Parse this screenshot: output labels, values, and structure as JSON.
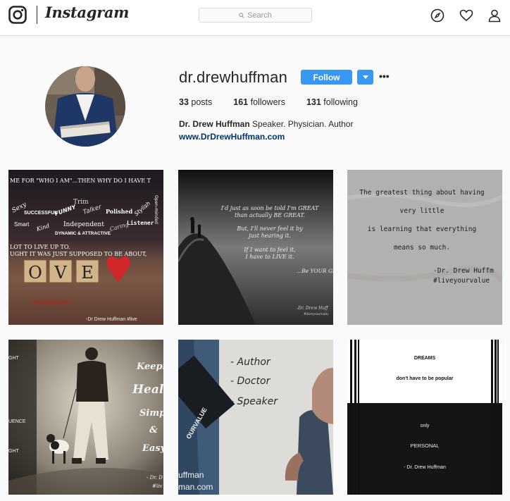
{
  "nav": {
    "wordmark": "Instagram",
    "search_placeholder": "Search",
    "icons": [
      "instagram-logo-icon",
      "search-icon",
      "compass-icon",
      "heart-icon",
      "person-icon"
    ]
  },
  "profile": {
    "username": "dr.drewhuffman",
    "follow_label": "Follow",
    "more_label": "•••",
    "posts_count": "33",
    "posts_label": "posts",
    "followers_count": "161",
    "followers_label": "followers",
    "following_count": "131",
    "following_label": "following",
    "full_name": "Dr. Drew Huffman",
    "bio": "Speaker. Physician. Author",
    "website": "www.DrDrewHuffman.com"
  },
  "posts": {
    "post1": {
      "line1": "ME FOR \"WHO I AM\"...THEN WHY DO I HAVE T",
      "words": [
        "Sexy",
        "SUCCESSFUL",
        "FUNNY",
        "Trim",
        "Talker",
        "Polished",
        "Stylish",
        "Open-minded",
        "Smart",
        "Kind",
        "Independent",
        "Caring",
        "Listener",
        "DYNAMIC & ATTRACTIVE"
      ],
      "line2": "LOT TO LIVE UP TO.",
      "line3": "UGHT IT WAS JUST SUPPOSED TO BE ABOUT,",
      "tiles": [
        "O",
        "V",
        "E"
      ],
      "sig": "-Dr Drew Huffman   #live"
    },
    "post2": {
      "l1": "I'd just as soon be told I'm GREAT",
      "l2": "than actually BE GREAT.",
      "l3": "But, I'll never feel it by",
      "l4": "just hearing it.",
      "l5": "If I want to feel it,",
      "l6": "I have to LIVE it.",
      "l7": "...Be YOUR GR",
      "sig1": "-Dr. Drew Huff",
      "sig2": "#liveyourvalu"
    },
    "post3": {
      "l1": "The greatest thing about having",
      "l2": "very little",
      "l3": "is learning that everything",
      "l4": "means so much.",
      "sig1": "-Dr. Drew Huffm",
      "sig2": "#liveyourvalue"
    },
    "post4": {
      "w1": "Keepin",
      "w2": "Healt",
      "w3": "Simp",
      "w4": "&",
      "w5": "Easy",
      "l1": "GHT",
      "l2": "UENCE",
      "l3": "GHT",
      "sig1": "- Dr. D",
      "sig2": "#liv"
    },
    "post5": {
      "l1": "- Author",
      "l2": "- Doctor",
      "l3": "- Speaker",
      "side": "OURVALUE",
      "b1": "uffman",
      "b2": "man.com"
    },
    "post6": {
      "t1": "DREAMS",
      "t2": "don't have to be popular",
      "t3": "only",
      "t4": "PERSONAL",
      "t5": "- Dr. Drew Huffman"
    }
  },
  "colors": {
    "follow_blue": "#3897f0",
    "link_navy": "#003569"
  }
}
